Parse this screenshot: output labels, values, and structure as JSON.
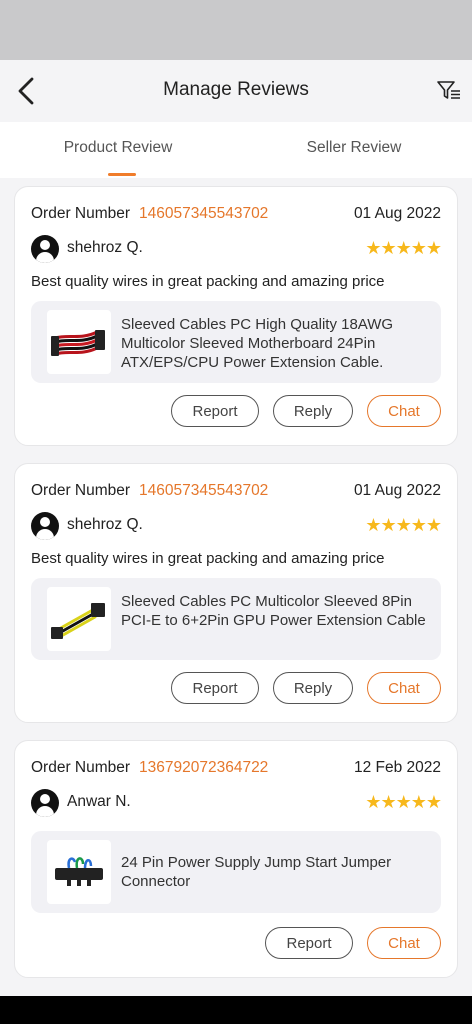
{
  "header": {
    "title": "Manage Reviews",
    "back_icon": "chevron-left-icon",
    "filter_icon": "filter-list-icon"
  },
  "tabs": [
    {
      "label": "Product Review",
      "active": true
    },
    {
      "label": "Seller Review",
      "active": false
    }
  ],
  "colors": {
    "accent": "#e5772b",
    "star": "#f7b81c"
  },
  "reviews": [
    {
      "order_label": "Order Number",
      "order_number": "146057345543702",
      "date": "01 Aug 2022",
      "user": "shehroz Q.",
      "rating": 5,
      "stars": "★★★★★",
      "text": "Best quality wires in great packing and amazing price",
      "product": "Sleeved Cables PC High Quality 18AWG Multicolor Sleeved Motherboard 24Pin ATX/EPS/CPU Power Extension Cable.",
      "actions": {
        "report": "Report",
        "reply": "Reply",
        "chat": "Chat"
      }
    },
    {
      "order_label": "Order Number",
      "order_number": "146057345543702",
      "date": "01 Aug 2022",
      "user": "shehroz Q.",
      "rating": 5,
      "stars": "★★★★★",
      "text": "Best quality wires in great packing and amazing price",
      "product": "Sleeved Cables PC Multicolor Sleeved 8Pin PCI-E to 6+2Pin GPU Power Extension Cable",
      "actions": {
        "report": "Report",
        "reply": "Reply",
        "chat": "Chat"
      }
    },
    {
      "order_label": "Order Number",
      "order_number": "136792072364722",
      "date": "12 Feb 2022",
      "user": "Anwar N.",
      "rating": 5,
      "stars": "★★★★★",
      "product": "24 Pin Power Supply Jump Start Jumper Connector",
      "actions": {
        "report": "Report",
        "chat": "Chat"
      }
    }
  ]
}
